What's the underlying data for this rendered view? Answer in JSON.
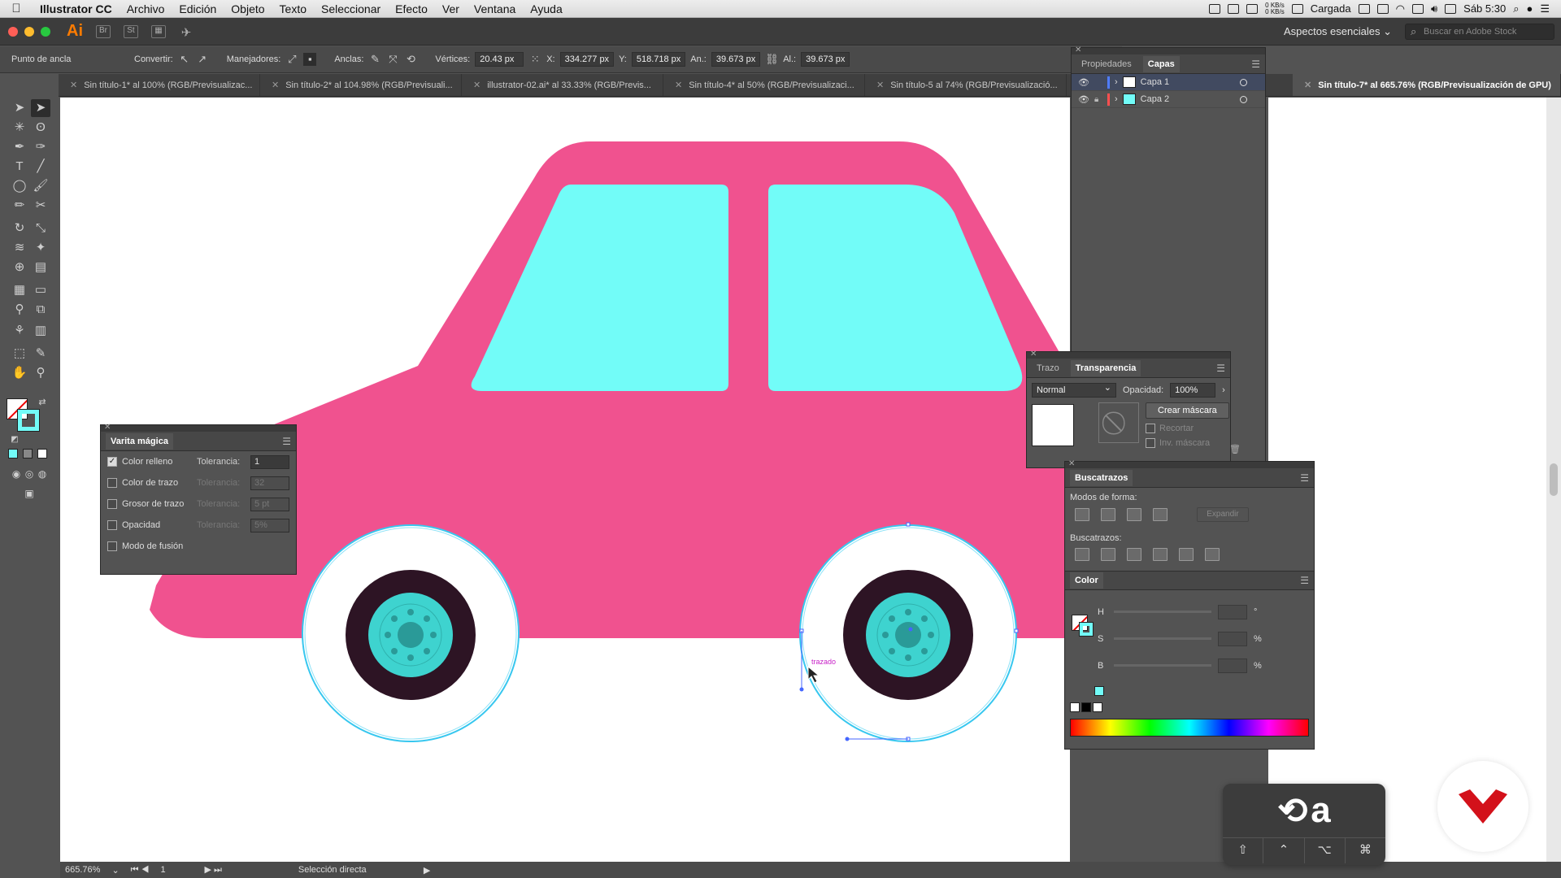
{
  "menubar": {
    "app": "Illustrator CC",
    "items": [
      "Archivo",
      "Edición",
      "Objeto",
      "Texto",
      "Seleccionar",
      "Efecto",
      "Ver",
      "Ventana",
      "Ayuda"
    ],
    "net_up": "0 KB/s",
    "net_down": "0 KB/s",
    "battery_label": "Cargada",
    "clock": "Sáb 5:30"
  },
  "appbar": {
    "logo": "Ai",
    "workspace": "Aspectos esenciales",
    "stock_placeholder": "Buscar en Adobe Stock"
  },
  "control": {
    "mode": "Punto de ancla",
    "convert": "Convertir:",
    "handles": "Manejadores:",
    "anchors": "Anclas:",
    "corners_label": "Vértices:",
    "corners_value": "20.43 px",
    "x_label": "X:",
    "x_value": "334.277 px",
    "y_label": "Y:",
    "y_value": "518.718 px",
    "w_label": "An.:",
    "w_value": "39.673 px",
    "h_label": "Al.:",
    "h_value": "39.673 px"
  },
  "tabs": [
    "Sin título-1* al 100% (RGB/Previsualizac...",
    "Sin título-2* al 104.98% (RGB/Previsuali...",
    "illustrator-02.ai* al 33.33% (RGB/Previs...",
    "Sin título-4* al 50% (RGB/Previsualizaci...",
    "Sin título-5 al 74% (RGB/Previsualizació...",
    "Sin título-7* al 665.76% (RGB/Previsualización de GPU)"
  ],
  "layers": {
    "tab_props": "Propiedades",
    "tab_layers": "Capas",
    "items": [
      {
        "name": "Capa 1",
        "color": "#4f7cff"
      },
      {
        "name": "Capa 2",
        "color": "#ff4f4f"
      }
    ]
  },
  "wand": {
    "title": "Varita mágica",
    "tol_label": "Tolerancia:",
    "rows": [
      {
        "label": "Color relleno",
        "checked": true,
        "value": "1"
      },
      {
        "label": "Color de trazo",
        "checked": false,
        "value": "32"
      },
      {
        "label": "Grosor de trazo",
        "checked": false,
        "value": "5 pt"
      },
      {
        "label": "Opacidad",
        "checked": false,
        "value": "5%"
      },
      {
        "label": "Modo de fusión",
        "checked": false
      }
    ]
  },
  "transparency": {
    "tab_stroke": "Trazo",
    "tab_transp": "Transparencia",
    "blend": "Normal",
    "opacity_label": "Opacidad:",
    "opacity": "100%",
    "make_mask": "Crear máscara",
    "clip": "Recortar",
    "invert": "Inv. máscara"
  },
  "pathfinder": {
    "title": "Buscatrazos",
    "shape_modes": "Modos de forma:",
    "expand": "Expandir",
    "pathfinders": "Buscatrazos:"
  },
  "color": {
    "title": "Color",
    "h": "H",
    "s": "S",
    "b": "B",
    "pct": "%",
    "deg": "°"
  },
  "canvas": {
    "hint": "trazado",
    "car_body": "#f0528f",
    "window": "#72fcf8",
    "tire": "#2d1424",
    "hub": "#3ed3cf",
    "selection": "#37c7ef"
  },
  "status": {
    "zoom": "665.76%",
    "artboard": "1",
    "tool": "Selección directa"
  },
  "shortcut": {
    "key": "a",
    "mods": [
      "⇧",
      "⌃",
      "⌥",
      "⌘"
    ]
  }
}
